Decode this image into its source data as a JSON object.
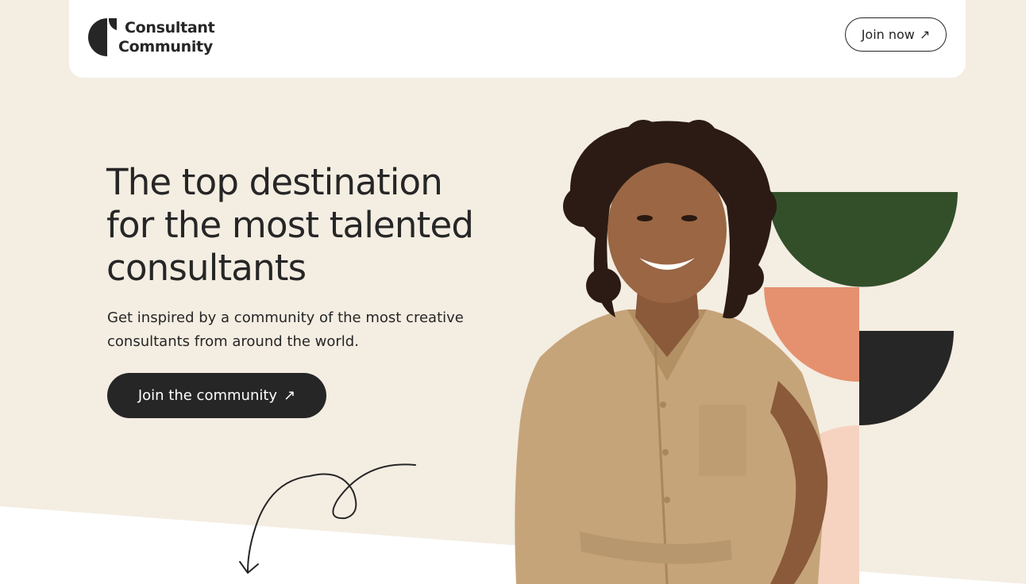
{
  "nav": {
    "logo_line1": "Consultant",
    "logo_line2": "Community",
    "join_label": "Join now",
    "arrow_glyph": "↗"
  },
  "hero": {
    "title_line1": "The top destination",
    "title_line2": "for the most talented",
    "title_line3": "consultants",
    "subtitle_line1": "Get inspired by a community of the most creative",
    "subtitle_line2": "consultants from around the world.",
    "cta_label": "Join the community",
    "cta_arrow": "↗"
  },
  "colors": {
    "background": "#f4ede2",
    "dark": "#262626",
    "green": "#324f2a",
    "coral": "#e5916f",
    "peach": "#f6d3c0",
    "white": "#ffffff"
  },
  "icons": {
    "logo": "consultant-community-logo-icon",
    "arrow": "arrow-up-right-icon",
    "curl_arrow": "hand-drawn-curly-arrow-icon"
  }
}
